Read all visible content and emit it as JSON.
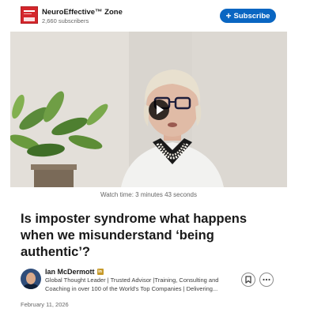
{
  "newsletter": {
    "name": "NeuroEffective™ Zone",
    "subscribers": "2,660 subscribers",
    "subscribe_label": "Subscribe",
    "logo_icon": "newsletter-logo"
  },
  "video": {
    "play_icon": "play-icon",
    "watch_time": "Watch time: 3 minutes 43 seconds"
  },
  "article": {
    "title": "Is imposter syndrome what happens when we misunderstand ‘being authentic’?",
    "date": "February 11, 2026"
  },
  "author": {
    "name": "Ian McDermott",
    "badge_icon": "linkedin-premium-icon",
    "description_line1": "Global Thought Leader | Trusted Advisor |Training, Consulting and",
    "description_line2": "Coaching in over 100 of the World's Top Companies | Delivering..."
  },
  "actions": {
    "save_icon": "bookmark-icon",
    "more_icon": "more-icon"
  },
  "colors": {
    "accent": "#0a66c2",
    "logo_red": "#d4262b",
    "badge_gold": "#c79a2a"
  }
}
